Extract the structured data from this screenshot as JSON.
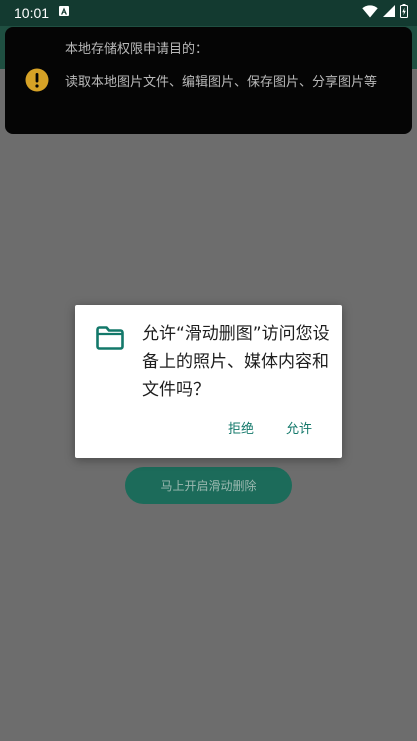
{
  "status_bar": {
    "time": "10:01"
  },
  "banner": {
    "title": "本地存储权限申请目的：",
    "body": "读取本地图片文件、编辑图片、保存图片、分享图片等"
  },
  "background": {
    "start_button_label": "马上开启滑动删除"
  },
  "dialog": {
    "message": "允许“滑动删图”访问您设备上的照片、媒体内容和文件吗？",
    "deny_label": "拒绝",
    "allow_label": "允许"
  },
  "icons": {
    "banner": "warning-icon",
    "dialog": "folder-icon"
  },
  "colors": {
    "status_bar": "#133a30",
    "scrim": "#6d6d6d",
    "banner_bg": "#050505",
    "warning": "#d6a226",
    "accent": "#13786a"
  }
}
